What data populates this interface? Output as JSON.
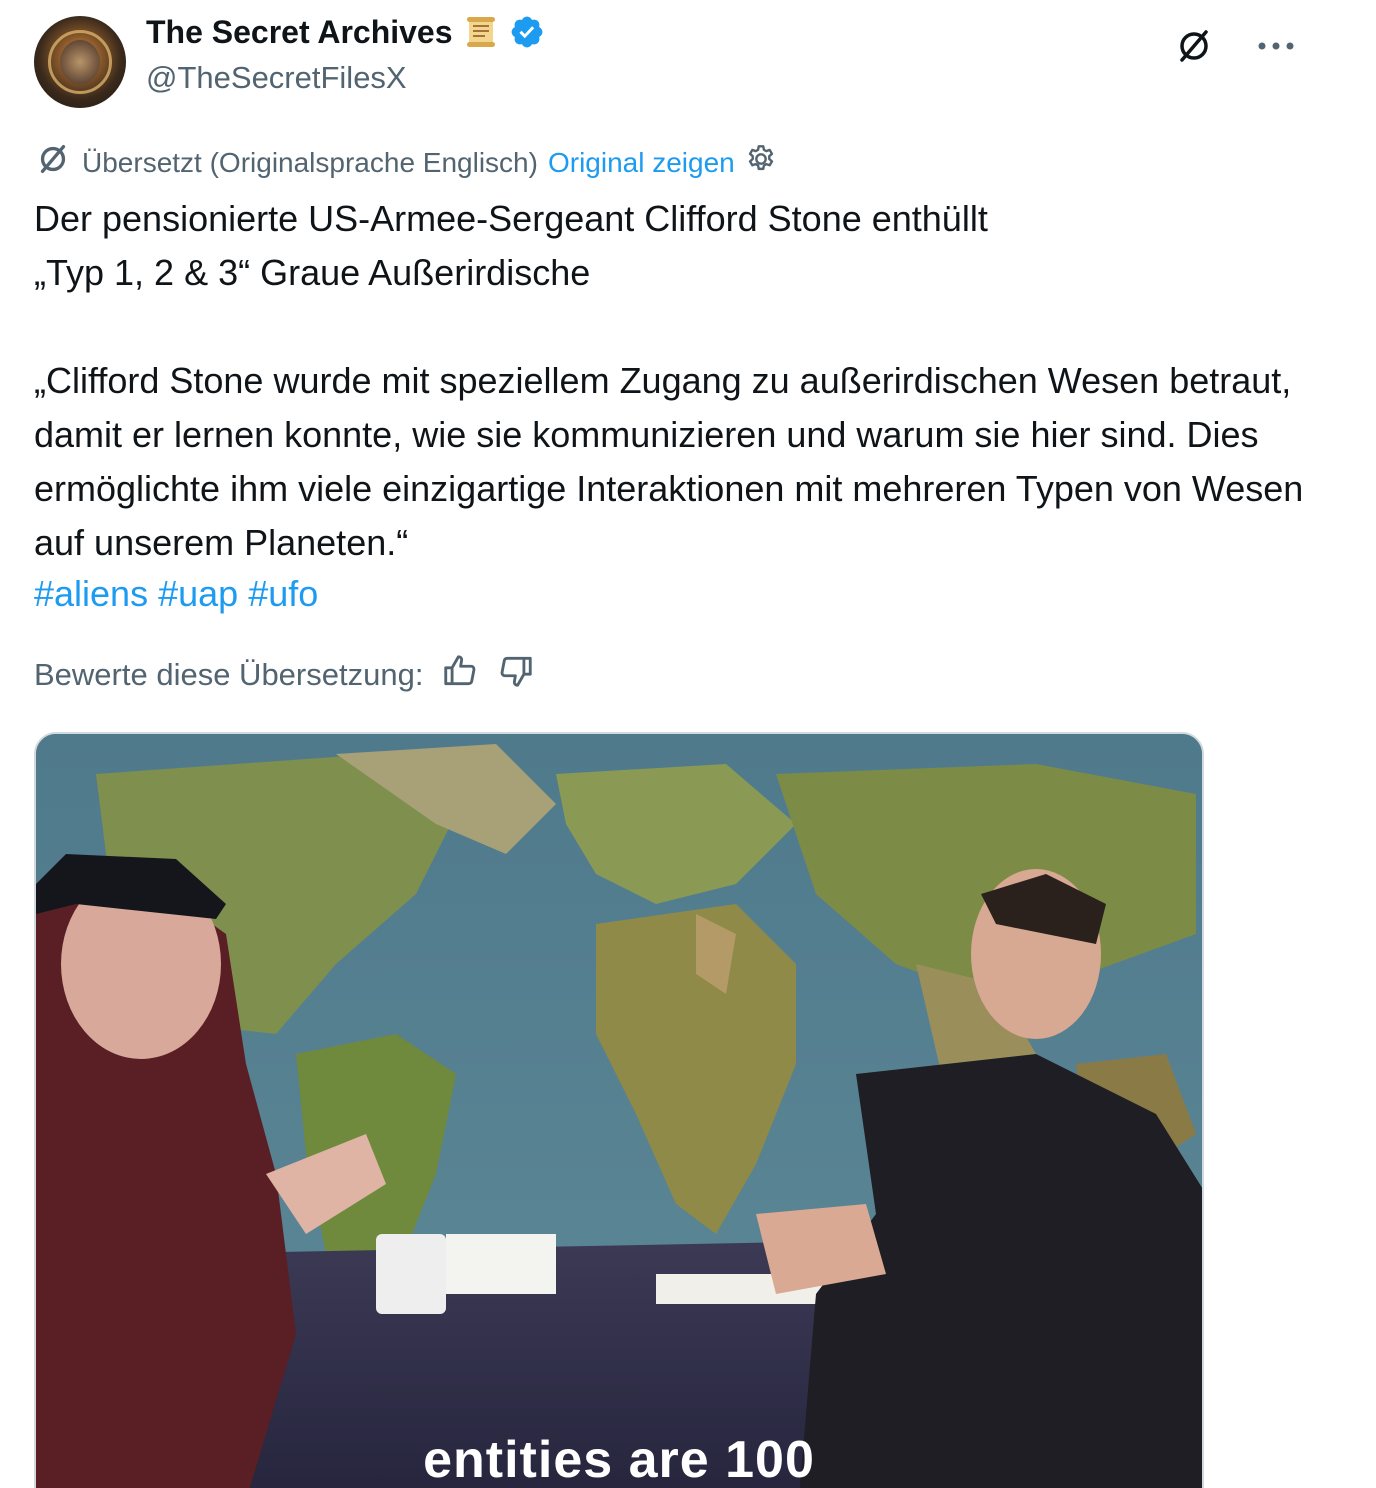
{
  "author": {
    "display_name": "The Secret Archives",
    "handle": "@TheSecretFilesX",
    "avatar_icon": "archive-emblem-avatar",
    "badge_emoji_icon": "scroll-icon",
    "verified_icon": "verified-badge-icon",
    "verified_color": "#1d9bf0"
  },
  "top_actions": {
    "grok_icon": "grok-icon",
    "more_icon": "more-icon"
  },
  "translation": {
    "note": "Übersetzt (Originalsprache Englisch)",
    "show_original": "Original zeigen",
    "settings_icon": "gear-icon",
    "translate_icon": "grok-icon"
  },
  "tweet": {
    "text": "Der pensionierte US-Armee-Sergeant Clifford Stone enthüllt\n„Typ 1, 2 & 3“ Graue Außerirdische\n\n„Clifford Stone wurde mit speziellem Zugang zu außerirdischen Wesen betraut, damit er lernen konnte, wie sie kommunizieren und warum sie hier sind. Dies ermöglichte ihm viele einzigartige Interaktionen mit mehreren Typen von Wesen auf unserem Planeten.“",
    "hashtags": [
      "#aliens",
      "#uap",
      "#ufo"
    ],
    "link_color": "#1d9bf0"
  },
  "rating": {
    "label": "Bewerte diese Übersetzung:",
    "thumbs_up_icon": "thumbs-up-icon",
    "thumbs_down_icon": "thumbs-down-icon"
  },
  "media": {
    "type": "video-still",
    "caption": "entities are 100"
  }
}
